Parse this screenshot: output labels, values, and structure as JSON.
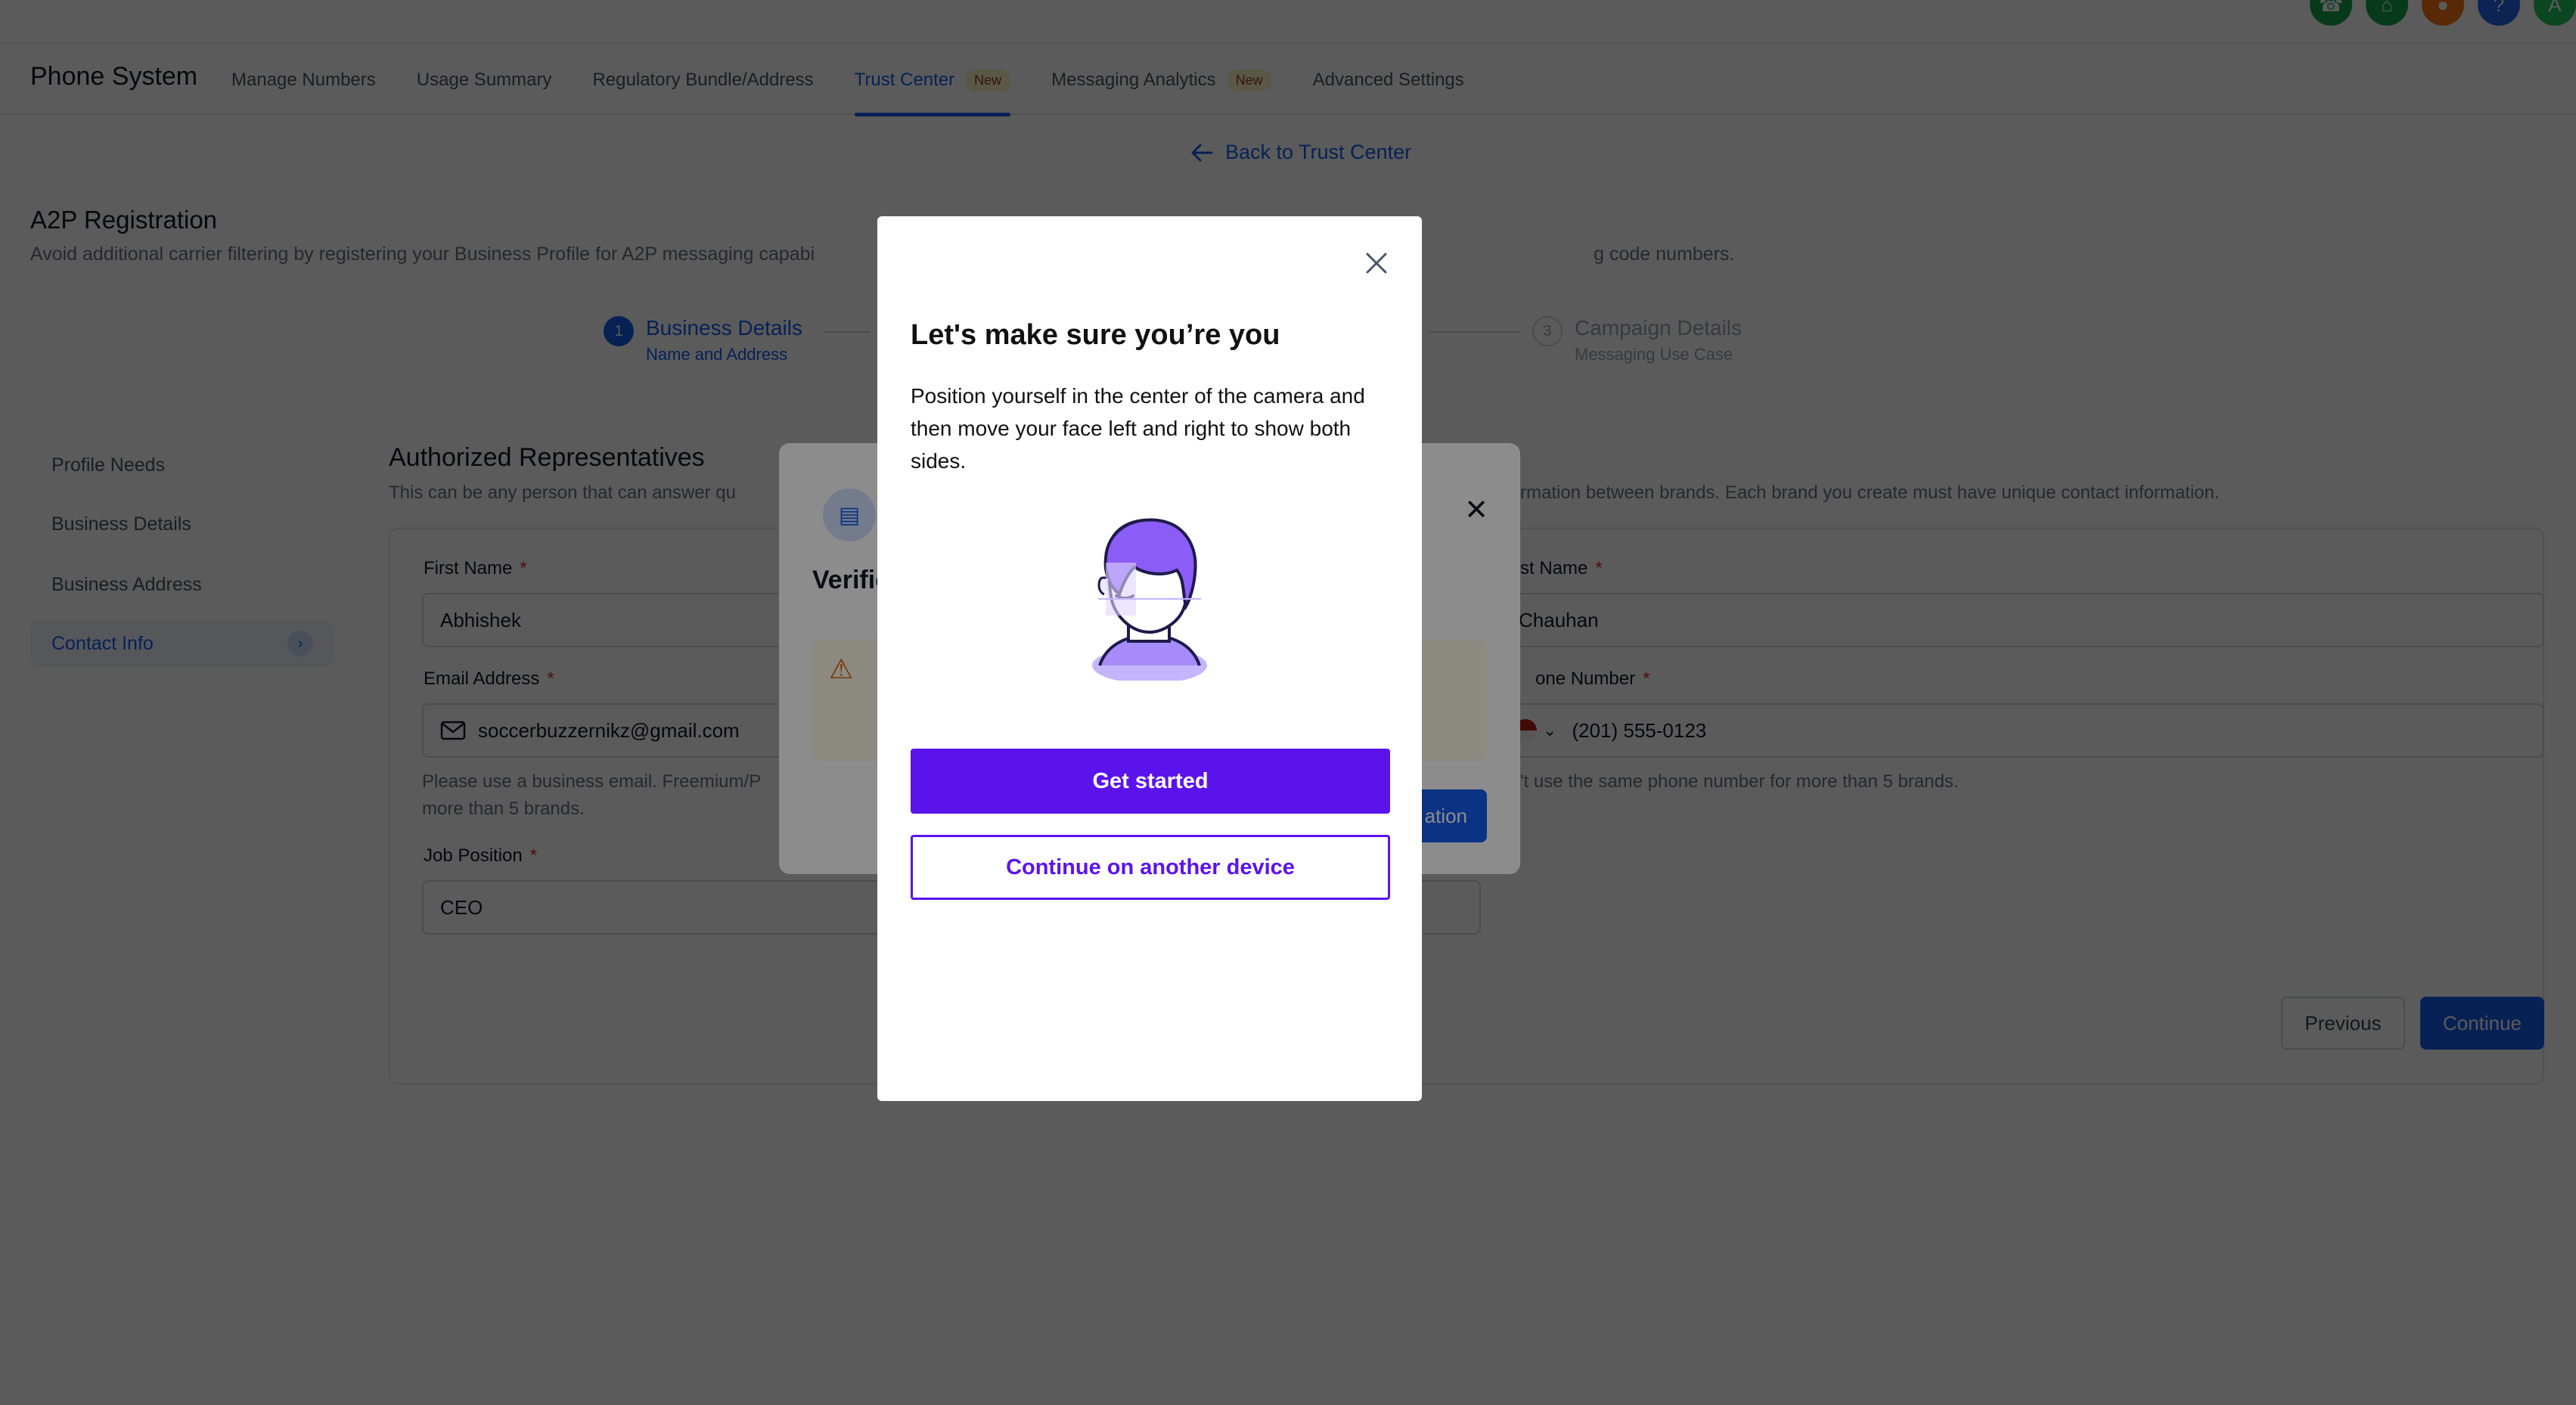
{
  "header": {
    "app_title": "Phone System",
    "tabs": [
      {
        "label": "Manage Numbers"
      },
      {
        "label": "Usage Summary"
      },
      {
        "label": "Regulatory Bundle/Address"
      },
      {
        "label": "Trust Center",
        "badge": "New"
      },
      {
        "label": "Messaging Analytics",
        "badge": "New"
      },
      {
        "label": "Advanced Settings"
      }
    ],
    "active_tab": "Trust Center",
    "top_icons": [
      "phone-icon",
      "home-icon",
      "bell-icon",
      "help-icon",
      "user-avatar-icon"
    ]
  },
  "back_link": "Back to Trust Center",
  "page": {
    "title": "A2P Registration",
    "subtitle_left": "Avoid additional carrier filtering by registering your Business Profile for A2P messaging capabi",
    "subtitle_right": "g code numbers."
  },
  "stepper": {
    "step1": {
      "num": "1",
      "title": "Business Details",
      "sub": "Name and Address"
    },
    "step3": {
      "num": "3",
      "title": "Campaign Details",
      "sub": "Messaging Use Case"
    }
  },
  "sidebar": {
    "items": [
      {
        "label": "Profile Needs"
      },
      {
        "label": "Business Details"
      },
      {
        "label": "Business Address"
      },
      {
        "label": "Contact Info"
      }
    ],
    "active": "Contact Info"
  },
  "form": {
    "section_title": "Authorized Representatives",
    "section_sub_left": "This can be any person that can answer qu",
    "section_sub_right": "rmation between brands. Each brand you create must have unique contact information.",
    "first_name_label": "First Name",
    "first_name_value": "Abhishek",
    "last_name_label": "st Name",
    "last_name_value": "Chauhan",
    "email_label": "Email Address",
    "email_value": "soccerbuzzernikz@gmail.com",
    "email_hint_line1": "Please use a business email. Freemium/P",
    "email_hint_line2": "more than 5 brands.",
    "phone_label": "one Number",
    "phone_value": "(201) 555-0123",
    "phone_hint": "'t use the same phone number for more than 5 brands.",
    "job_label": "Job Position",
    "job_value": "CEO",
    "required_mark": "*",
    "previous_label": "Previous",
    "continue_label": "Continue"
  },
  "verification_dialog": {
    "title_fragment": "Verific",
    "button_fragment": "ation"
  },
  "modal": {
    "title": "Let's make sure you’re you",
    "body": "Position yourself in the center of the camera and then move your face left and right to show both sides.",
    "primary_button": "Get started",
    "secondary_button": "Continue on another device"
  },
  "colors": {
    "brand_blue": "#155eef",
    "modal_purple": "#5b13ec",
    "illustration_purple": "#8b5cf6"
  }
}
